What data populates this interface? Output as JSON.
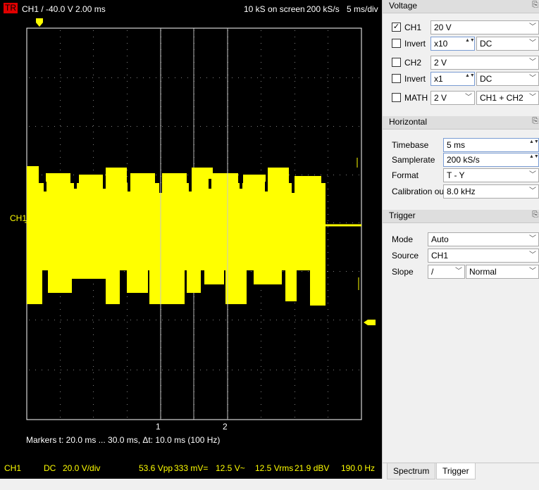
{
  "top_bar": {
    "trigger_badge": "TR",
    "trigger_info": "CH1  /  -40.0 V  2.00 ms",
    "samples": "10 kS on screen",
    "samplerate": "200 kS/s",
    "timebase": "5 ms/div"
  },
  "graph": {
    "channel_label": "CH1",
    "marker_1": "1",
    "marker_2": "2",
    "trace_color": "#ffff00",
    "grid_color": "#808080",
    "frame_color": "#ffffff"
  },
  "markers_text": "Markers   t: 20.0 ms ... 30.0 ms,  Δt: 10.0 ms (100 Hz)",
  "bottom_bar": {
    "channel": "CH1",
    "coupling": "DC",
    "volts_div": "20.0 V/div",
    "vpp": "53.6 Vpp",
    "mean": "333 mV=",
    "ac": "12.5 V~",
    "vrms": "12.5 Vrms",
    "dbv": "21.9 dBV",
    "freq": "190.0 Hz"
  },
  "voltage": {
    "title": "Voltage",
    "ch1": {
      "label": "CH1",
      "checked": "✓",
      "gain": "20 V"
    },
    "invert1": {
      "label": "Invert",
      "probe": "x10",
      "coupling": "DC"
    },
    "ch2": {
      "label": "CH2",
      "gain": "2 V"
    },
    "invert2": {
      "label": "Invert",
      "probe": "x1",
      "coupling": "DC"
    },
    "math": {
      "label": "MATH",
      "gain": "2 V",
      "mode": "CH1 + CH2"
    }
  },
  "horizontal": {
    "title": "Horizontal",
    "timebase_label": "Timebase",
    "timebase_value": "5 ms",
    "samplerate_label": "Samplerate",
    "samplerate_value": "200 kS/s",
    "format_label": "Format",
    "format_value": "T - Y",
    "calibration_label": "Calibration out",
    "calibration_value": "8.0 kHz"
  },
  "trigger": {
    "title": "Trigger",
    "mode_label": "Mode",
    "mode_value": "Auto",
    "source_label": "Source",
    "source_value": "CH1",
    "slope_label": "Slope",
    "slope_value": "/",
    "slope_extra": "Normal"
  },
  "tabs": {
    "spectrum": "Spectrum",
    "trigger": "Trigger"
  },
  "icons": {
    "dock_pin": "⎘",
    "combo_arrow": "﹀",
    "spin_arrows": "▲▼"
  }
}
